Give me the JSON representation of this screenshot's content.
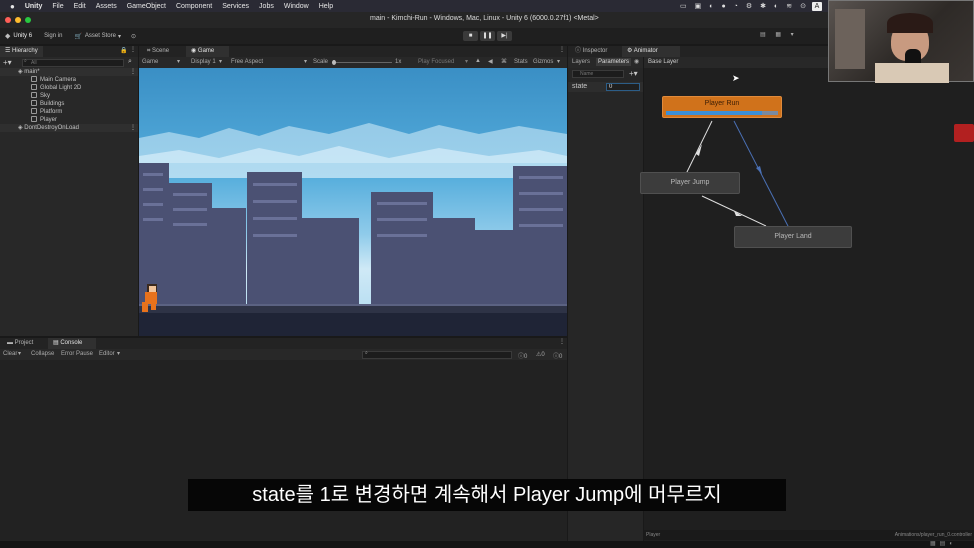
{
  "menubar": {
    "app": "Unity",
    "items": [
      "File",
      "Edit",
      "Assets",
      "GameObject",
      "Component",
      "Services",
      "Jobs",
      "Window",
      "Help"
    ],
    "status_letter": "A"
  },
  "window": {
    "title": "main - Kimchi-Run - Windows, Mac, Linux - Unity 6 (6000.0.27f1) <Metal>"
  },
  "toolbar": {
    "project": "Unity 6",
    "sign_in": "Sign in",
    "asset_store": "Asset Store"
  },
  "hierarchy": {
    "tab": "Hierarchy",
    "search_placeholder": "All",
    "scene": "main*",
    "children": [
      "Main Camera",
      "Global Light 2D",
      "Sky",
      "Buildings",
      "Platform",
      "Player"
    ],
    "dont_destroy": "DontDestroyOnLoad"
  },
  "game_view": {
    "tabs": [
      "Scene",
      "Game"
    ],
    "display_mode": "Game",
    "display": "Display 1",
    "aspect": "Free Aspect",
    "scale_label": "Scale",
    "scale_value": "1x",
    "play_focused": "Play Focused",
    "stats": "Stats",
    "gizmos": "Gizmos"
  },
  "inspector": {
    "tab": "Inspector",
    "animator_tab": "Animator",
    "layers": "Layers",
    "parameters": "Parameters",
    "base_layer": "Base Layer",
    "search_placeholder": "Name",
    "param_name": "state",
    "param_value": "0"
  },
  "animator": {
    "states": {
      "run": "Player Run",
      "jump": "Player Jump",
      "land": "Player Land"
    },
    "footer_left": "Player",
    "footer_right": "Animations/player_run_0.controller"
  },
  "console": {
    "tabs": [
      "Project",
      "Console"
    ],
    "clear": "Clear",
    "collapse": "Collapse",
    "error_pause": "Error Pause",
    "editor": "Editor",
    "count_errors": "0",
    "count_warnings": "0",
    "count_logs": "0"
  },
  "subtitle": "state를 1로 변경하면 계속해서 Player Jump에 머무르지",
  "colors": {
    "accent_orange": "#d0721b",
    "selection_blue": "#2c5d87",
    "sky": "#4aa6d8",
    "building": "#4b5173"
  }
}
